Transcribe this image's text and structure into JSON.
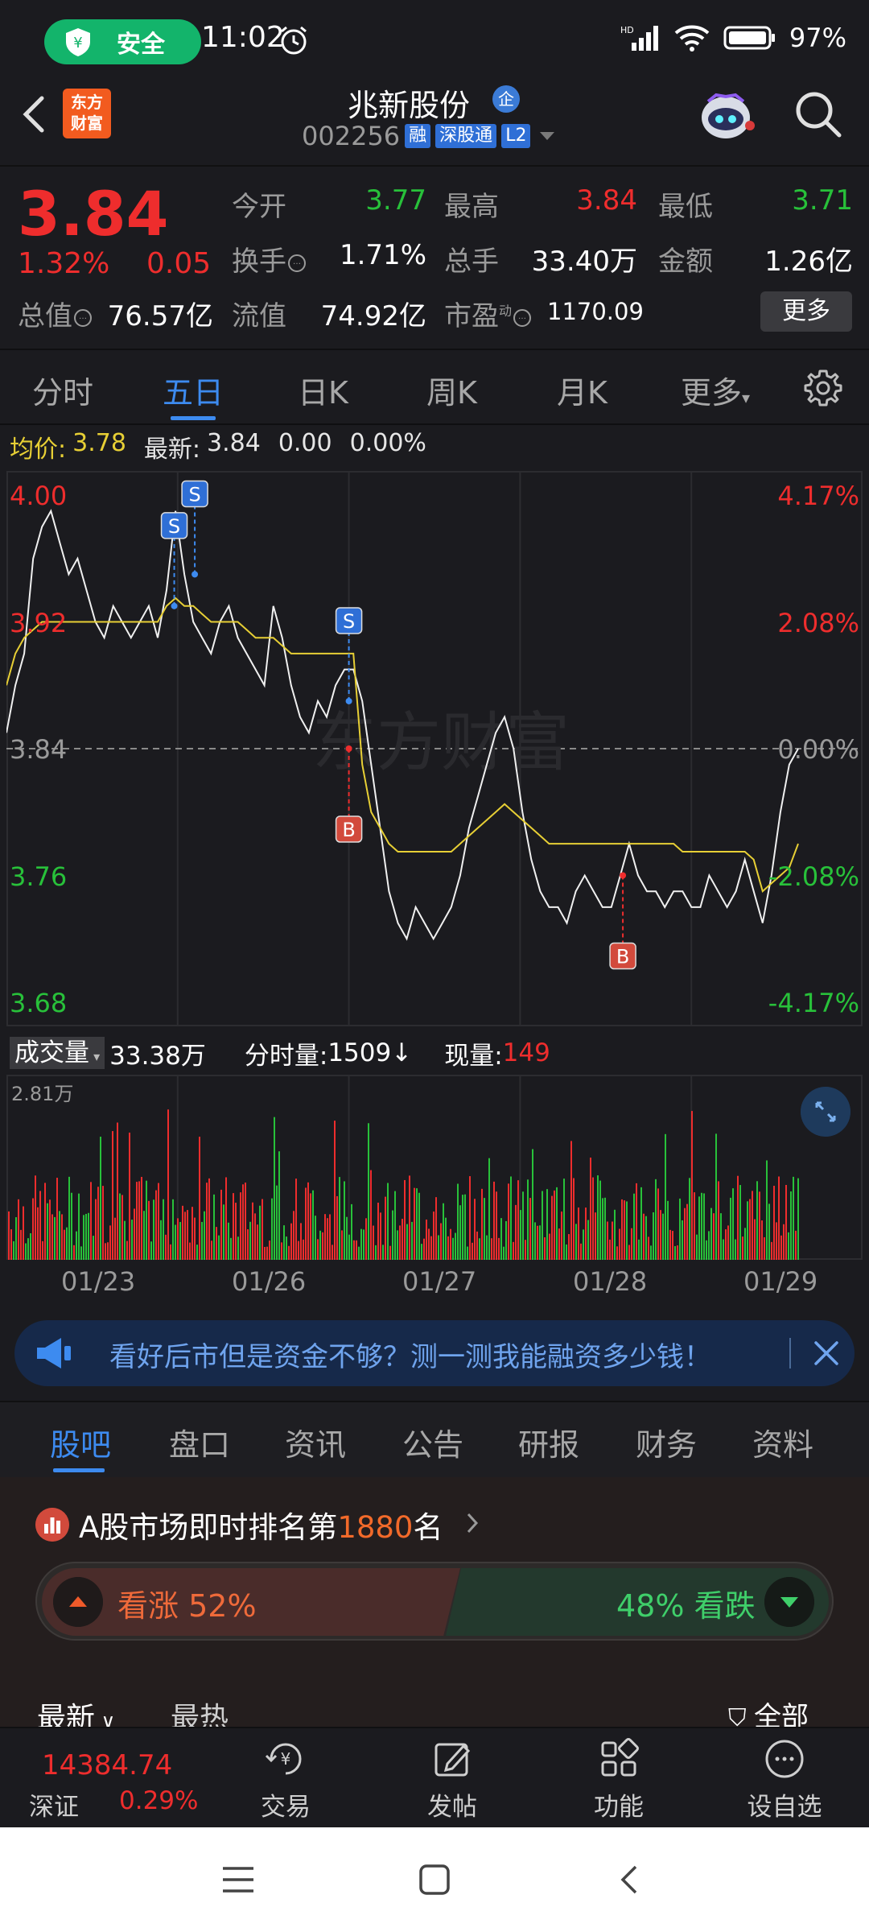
{
  "status_bar": {
    "safe_label": "安全",
    "time": "11:02",
    "network": "HD",
    "battery_pct": "97%"
  },
  "header": {
    "logo_line1": "东方",
    "logo_line2": "财富",
    "stock_name": "兆新股份",
    "badge_qi": "企",
    "stock_code": "002256",
    "tags": [
      "融",
      "深股通",
      "L2"
    ]
  },
  "quote": {
    "price": "3.84",
    "change_pct": "1.32%",
    "change_abs": "0.05",
    "open_label": "今开",
    "open_value": "3.77",
    "high_label": "最高",
    "high_value": "3.84",
    "low_label": "最低",
    "low_value": "3.71",
    "turnover_label": "换手",
    "turnover_value": "1.71%",
    "volume_label": "总手",
    "volume_value": "33.40万",
    "amount_label": "金额",
    "amount_value": "1.26亿",
    "mktcap_label": "总值",
    "mktcap_value": "76.57亿",
    "float_label": "流值",
    "float_value": "74.92亿",
    "pe_label": "市盈",
    "pe_sup": "动",
    "pe_value": "1170.09",
    "more_button": "更多"
  },
  "period_tabs": [
    "分时",
    "五日",
    "日K",
    "周K",
    "月K",
    "更多"
  ],
  "chart_header": {
    "avg_label": "均价:",
    "avg_value": "3.78",
    "latest_label": "最新:",
    "latest_value": "3.84",
    "chg_value": "0.00",
    "chg_pct": "0.00%"
  },
  "chart_data": {
    "type": "line",
    "y_labels_left": [
      "4.00",
      "3.92",
      "3.84",
      "3.76",
      "3.68"
    ],
    "y_labels_right": [
      "4.17%",
      "2.08%",
      "0.00%",
      "-2.08%",
      "-4.17%"
    ],
    "ylim": [
      3.68,
      4.0
    ],
    "base_price": 3.84,
    "days": [
      "01/23",
      "01/26",
      "01/27",
      "01/28",
      "01/29"
    ],
    "series": [
      {
        "values": [
          3.85,
          3.88,
          3.9,
          3.96,
          3.98,
          3.99,
          3.97,
          3.95,
          3.96,
          3.94,
          3.92,
          3.91,
          3.93,
          3.92,
          3.91,
          3.92,
          3.93,
          3.91,
          3.94,
          3.99,
          3.95,
          3.92,
          3.91,
          3.9,
          3.92,
          3.93,
          3.91,
          3.9,
          3.89,
          3.88,
          3.93,
          3.91,
          3.88,
          3.86,
          3.85,
          3.87,
          3.86,
          3.88,
          3.89,
          3.89,
          3.87,
          3.83,
          3.79,
          3.75,
          3.73,
          3.72,
          3.74,
          3.73,
          3.72,
          3.73,
          3.74,
          3.76,
          3.79,
          3.81,
          3.83,
          3.85,
          3.86,
          3.84,
          3.8,
          3.77,
          3.75,
          3.74,
          3.74,
          3.73,
          3.75,
          3.76,
          3.75,
          3.74,
          3.74,
          3.76,
          3.78,
          3.76,
          3.75,
          3.75,
          3.74,
          3.75,
          3.75,
          3.74,
          3.74,
          3.76,
          3.75,
          3.74,
          3.75,
          3.77,
          3.75,
          3.73,
          3.76,
          3.8,
          3.83,
          3.84
        ]
      },
      {
        "values": [
          3.88,
          3.9,
          3.91,
          3.915,
          3.92,
          3.92,
          3.92,
          3.92,
          3.92,
          3.92,
          3.92,
          3.92,
          3.92,
          3.92,
          3.92,
          3.92,
          3.92,
          3.92,
          3.93,
          3.935,
          3.93,
          3.93,
          3.925,
          3.92,
          3.92,
          3.92,
          3.92,
          3.915,
          3.91,
          3.91,
          3.91,
          3.905,
          3.9,
          3.9,
          3.9,
          3.9,
          3.9,
          3.9,
          3.9,
          3.9,
          3.83,
          3.8,
          3.79,
          3.78,
          3.775,
          3.775,
          3.775,
          3.775,
          3.775,
          3.775,
          3.775,
          3.78,
          3.785,
          3.79,
          3.795,
          3.8,
          3.805,
          3.8,
          3.795,
          3.79,
          3.785,
          3.78,
          3.78,
          3.78,
          3.78,
          3.78,
          3.78,
          3.78,
          3.78,
          3.78,
          3.78,
          3.78,
          3.78,
          3.78,
          3.78,
          3.78,
          3.775,
          3.775,
          3.775,
          3.775,
          3.775,
          3.775,
          3.775,
          3.775,
          3.77,
          3.75,
          3.755,
          3.76,
          3.765,
          3.78
        ]
      }
    ],
    "markers": [
      {
        "label": "S",
        "day_index": 0.98,
        "price": 3.93
      },
      {
        "label": "S",
        "day_index": 1.1,
        "price": 3.95
      },
      {
        "label": "S",
        "day_index": 2.0,
        "price": 3.87
      },
      {
        "label": "B",
        "day_index": 2.0,
        "price": 3.84
      },
      {
        "label": "B",
        "day_index": 3.6,
        "price": 3.76
      }
    ]
  },
  "volume": {
    "select_label": "成交量",
    "total": "33.38万",
    "minute_label": "分时量:",
    "minute_value": "1509",
    "current_label": "现量:",
    "current_value": "149",
    "max_label": "2.81万"
  },
  "promo": {
    "text": "看好后市但是资金不够？测一测我能融资多少钱！"
  },
  "bottom_tabs": [
    "股吧",
    "盘口",
    "资讯",
    "公告",
    "研报",
    "财务",
    "资料"
  ],
  "rank": {
    "prefix": "A股市场即时排名第",
    "number": "1880",
    "suffix": "名"
  },
  "sentiment": {
    "up_label": "看涨",
    "up_pct": "52%",
    "down_pct": "48%",
    "down_label": "看跌",
    "up_value": 52,
    "down_value": 48
  },
  "feed_sort": {
    "latest": "最新",
    "hot": "最热",
    "filter": "全部"
  },
  "bottom_nav": {
    "index_value": "14384.74",
    "index_name": "深证",
    "index_pct": "0.29%",
    "items": [
      "交易",
      "发帖",
      "功能",
      "设自选"
    ]
  },
  "colors": {
    "up": "#ee2d2d",
    "down": "#28c13a",
    "accent": "#3d8bf0",
    "avg_line": "#e7cf35"
  }
}
